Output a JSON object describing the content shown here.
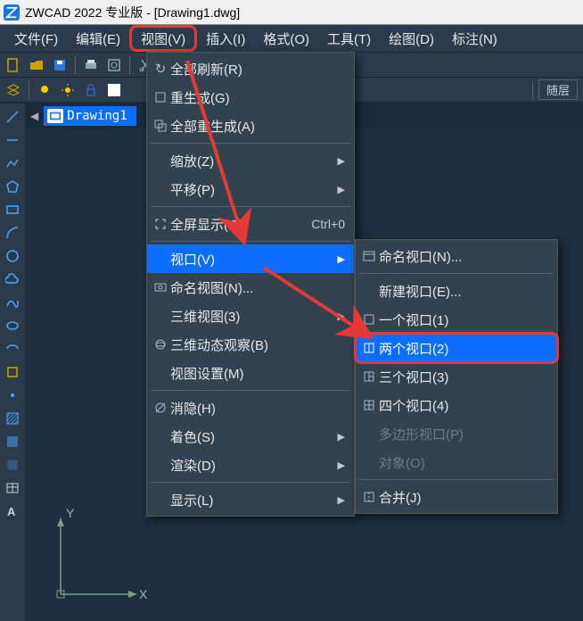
{
  "titlebar": {
    "text": "ZWCAD 2022 专业版 - [Drawing1.dwg]"
  },
  "menubar": {
    "file": "文件(F)",
    "edit": "编辑(E)",
    "view": "视图(V)",
    "insert": "插入(I)",
    "format": "格式(O)",
    "tools": "工具(T)",
    "draw": "绘图(D)",
    "dim": "标注(N)"
  },
  "tab": {
    "label": "Drawing1"
  },
  "layer_label": "随层",
  "view_menu": {
    "refresh_all": "全部刷新(R)",
    "regen": "重生成(G)",
    "regen_all": "全部重生成(A)",
    "zoom": "缩放(Z)",
    "pan": "平移(P)",
    "fullscreen": "全屏显示(C)",
    "fullscreen_sc": "Ctrl+0",
    "viewport": "视口(V)",
    "named_view": "命名视图(N)...",
    "view3d": "三维视图(3)",
    "orbit3d": "三维动态观察(B)",
    "view_settings": "视图设置(M)",
    "hide": "消隐(H)",
    "shade": "着色(S)",
    "render": "渲染(D)",
    "display": "显示(L)"
  },
  "viewport_submenu": {
    "named": "命名视口(N)...",
    "new": "新建视口(E)...",
    "one": "一个视口(1)",
    "two": "两个视口(2)",
    "three": "三个视口(3)",
    "four": "四个视口(4)",
    "polygon": "多边形视口(P)",
    "object": "对象(O)",
    "merge": "合并(J)"
  },
  "axis": {
    "x": "X",
    "y": "Y"
  }
}
